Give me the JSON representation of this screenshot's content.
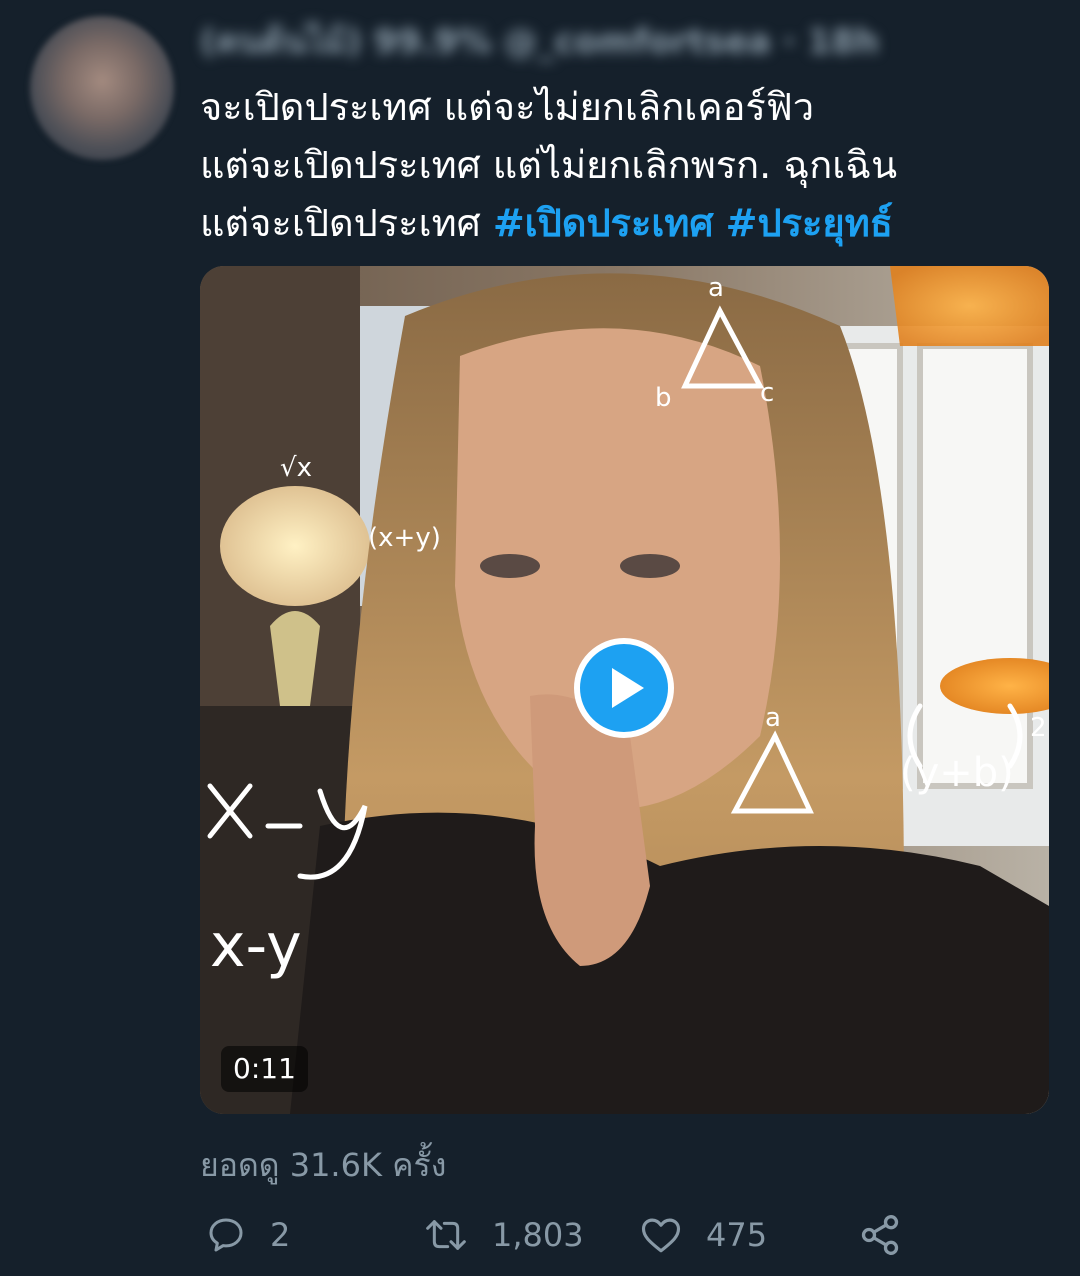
{
  "tweet": {
    "header_text": "(คนต้นไม้) 99.9% @_comfortsea · 18h",
    "text_line1": "จะเปิดประเทศ แต่จะไม่ยกเลิกเคอร์ฟิว",
    "text_line2": " แต่จะเปิดประเทศ แต่ไม่ยกเลิกพรก. ฉุกเฉิน",
    "text_line3": "แต่จะเปิดประเทศ ",
    "hashtag1": "#เปิดประเทศ",
    "hashtag2": "#ประยุทธ์"
  },
  "media": {
    "duration": "0:11",
    "overlay_math": [
      "a",
      "b",
      "c",
      "√x",
      "(x+y)",
      "x-y",
      "(y+b)",
      "2",
      "a"
    ]
  },
  "views_text": "ยอดดู 31.6K ครั้ง",
  "actions": {
    "reply_count": "2",
    "retweet_count": "1,803",
    "like_count": "475"
  },
  "colors": {
    "background": "#15202b",
    "accent": "#1da1f2",
    "muted": "#8899a6"
  },
  "icons": [
    "reply-icon",
    "retweet-icon",
    "like-icon",
    "share-icon",
    "play-icon"
  ]
}
